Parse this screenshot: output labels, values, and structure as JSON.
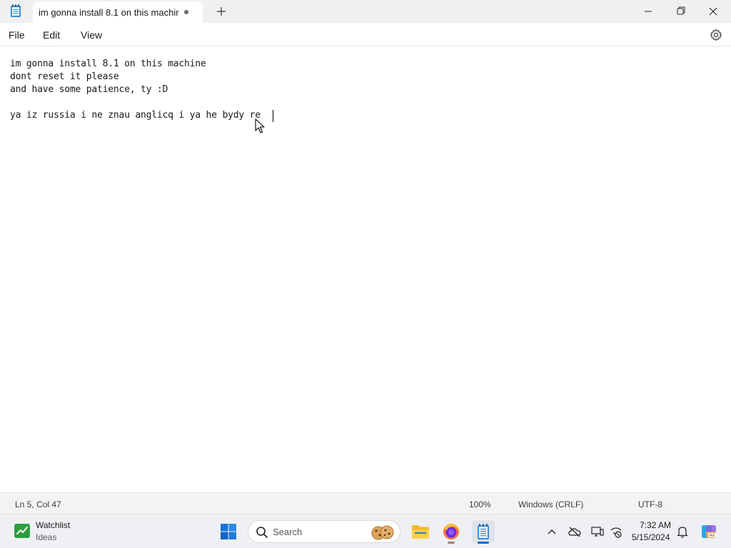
{
  "window": {
    "tab_title": "im gonna install 8.1 on this machin",
    "unsaved_indicator_icon": "dot-icon"
  },
  "menu": {
    "file": "File",
    "edit": "Edit",
    "view": "View"
  },
  "editor": {
    "lines": [
      "im gonna install 8.1 on this machine",
      "dont reset it please",
      "and have some patience, ty :D",
      "",
      "ya iz russia i ne znau anglicq i ya he bydy re"
    ]
  },
  "status": {
    "position": "Ln 5, Col 47",
    "zoom": "100%",
    "line_ending": "Windows (CRLF)",
    "encoding": "UTF-8"
  },
  "taskbar": {
    "widget_title": "Watchlist",
    "widget_subtitle": "Ideas",
    "search_placeholder": "Search",
    "clock_time": "7:32 AM",
    "clock_date": "5/15/2024",
    "apps": [
      "file-explorer-icon",
      "firefox-icon",
      "notepad-icon"
    ]
  },
  "colors": {
    "accent": "#0067c0",
    "titlebar_bg": "#f0f0f0",
    "taskbar_bg": "#eef0f3"
  }
}
